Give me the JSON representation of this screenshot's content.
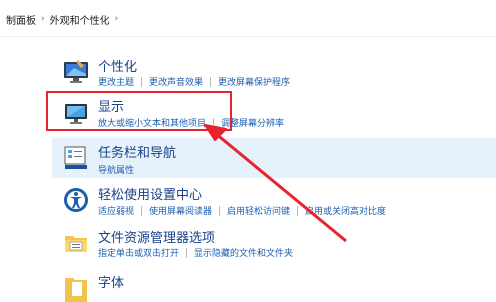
{
  "breadcrumb": [
    "制面板",
    "外观和个性化"
  ],
  "items": [
    {
      "title": "个性化",
      "links": [
        "更改主题",
        "更改声音效果",
        "更改屏幕保护程序"
      ]
    },
    {
      "title": "显示",
      "links": [
        "放大或缩小文本和其他项目",
        "调整屏幕分辨率"
      ]
    },
    {
      "title": "任务栏和导航",
      "links": [
        "导航属性"
      ]
    },
    {
      "title": "轻松使用设置中心",
      "links": [
        "适应弱视",
        "使用屏幕阅读器",
        "启用轻松访问键",
        "启用或关闭高对比度"
      ]
    },
    {
      "title": "文件资源管理器选项",
      "links": [
        "指定单击或双击打开",
        "显示隐藏的文件和文件夹"
      ]
    },
    {
      "title": "字体",
      "links": []
    }
  ],
  "colors": {
    "annotation": "#e8232c",
    "link": "#1c5fb0",
    "title": "#1a3f8a",
    "selected_bg": "#e5f1fb"
  }
}
